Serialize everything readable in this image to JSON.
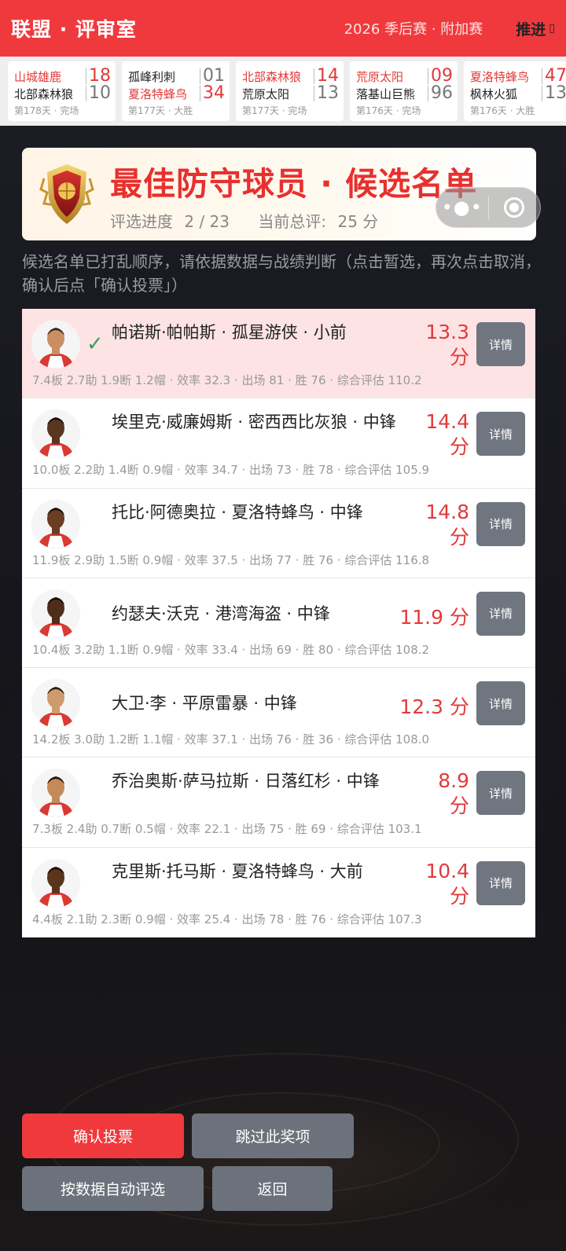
{
  "header": {
    "title": "联盟 · 评审室",
    "season": "2026  季后赛 · 附加赛",
    "advance_label": "推进",
    "advance_icon": "chevron-right-icon"
  },
  "ticker": [
    {
      "team1": "山城雄鹿",
      "score1": "18",
      "team2": "北部森林狼",
      "score2": "10",
      "winner": 1,
      "meta": "第178天 · 完场"
    },
    {
      "team1": "孤峰利刺",
      "score1": "01",
      "team2": "夏洛特蜂鸟",
      "score2": "34",
      "winner": 2,
      "meta": "第177天 · 大胜"
    },
    {
      "team1": "北部森林狼",
      "score1": "14",
      "team2": "荒原太阳",
      "score2": "13",
      "winner": 1,
      "meta": "第177天 · 完场"
    },
    {
      "team1": "荒原太阳",
      "score1": "09",
      "team2": "落基山巨熊",
      "score2": "96",
      "winner": 1,
      "meta": "第176天 · 完场"
    },
    {
      "team1": "夏洛特蜂鸟",
      "score1": "47",
      "team2": "枫林火狐",
      "score2": "13",
      "winner": 1,
      "meta": "第176天 · 大胜"
    }
  ],
  "award": {
    "title": "最佳防守球员 · 候选名单",
    "progress_label": "评选进度",
    "progress_value": "2 / 23",
    "total_label": "当前总评:",
    "total_value": "25 分",
    "badge_icon": "trophy-shield-icon"
  },
  "capsule": {
    "more_icon": "more-dots-icon",
    "close_icon": "target-icon"
  },
  "instructions": "候选名单已打乱顺序，请依据数据与战绩判断（点击暂选，再次点击取消，确认后点「确认投票」）",
  "detail_label": "详情",
  "candidates": [
    {
      "name": "帕诺斯·帕帕斯 · 孤星游侠 · 小前",
      "points": "13.3 分",
      "stats": "7.4板 2.7助 1.9断 1.2帽 · 效率 32.3 · 出场 81 · 胜 76 · 综合评估 110.2",
      "selected": true
    },
    {
      "name": "埃里克·威廉姆斯 · 密西西比灰狼 · 中锋",
      "points": "14.4 分",
      "stats": "10.0板 2.2助 1.4断 0.9帽 · 效率 34.7 · 出场 73 · 胜 78 · 综合评估 105.9",
      "selected": false
    },
    {
      "name": "托比·阿德奥拉 · 夏洛特蜂鸟 · 中锋",
      "points": "14.8 分",
      "stats": "11.9板 2.9助 1.5断 0.9帽 · 效率 37.5 · 出场 77 · 胜 76 · 综合评估 116.8",
      "selected": false
    },
    {
      "name": "约瑟夫·沃克 · 港湾海盗 · 中锋",
      "points": "11.9 分",
      "stats": "10.4板 3.2助 1.1断 0.9帽 · 效率 33.4 · 出场 69 · 胜 80 · 综合评估 108.2",
      "selected": false
    },
    {
      "name": "大卫·李 · 平原雷暴 · 中锋",
      "points": "12.3 分",
      "stats": "14.2板 3.0助 1.2断 1.1帽 · 效率 37.1 · 出场 76 · 胜 36 · 综合评估 108.0",
      "selected": false
    },
    {
      "name": "乔治奥斯·萨马拉斯 · 日落红杉 · 中锋",
      "points": "8.9 分",
      "stats": "7.3板 2.4助 0.7断 0.5帽 · 效率 22.1 · 出场 75 · 胜 69 · 综合评估 103.1",
      "selected": false
    },
    {
      "name": "克里斯·托马斯 · 夏洛特蜂鸟 · 大前",
      "points": "10.4 分",
      "stats": "4.4板 2.1助 2.3断 0.9帽 · 效率 25.4 · 出场 78 · 胜 76 · 综合评估 107.3",
      "selected": false
    }
  ],
  "buttons": {
    "confirm": "确认投票",
    "skip": "跳过此奖项",
    "auto": "按数据自动评选",
    "back": "返回"
  },
  "colors": {
    "accent": "#f0393d",
    "score_red": "#e23a3a",
    "button_grey": "#6c727b"
  }
}
